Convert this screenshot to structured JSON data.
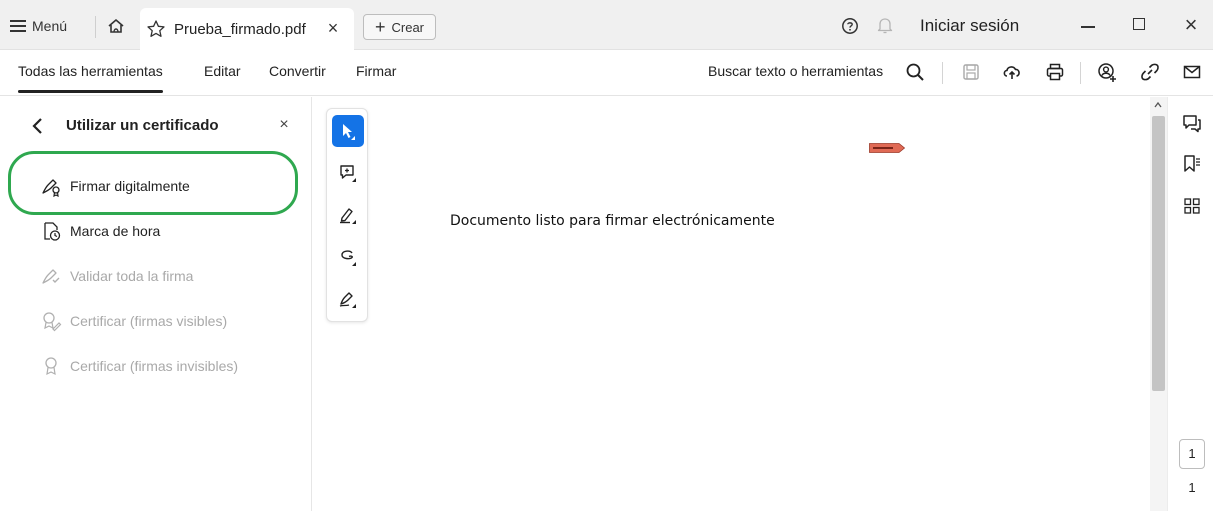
{
  "titlebar": {
    "menu_label": "Menú",
    "tab_title": "Prueba_firmado.pdf",
    "tab_close": "×",
    "create_plus": "+",
    "create_label": "Crear",
    "signin_label": "Iniciar sesión",
    "close_glyph": "×"
  },
  "toolbar": {
    "tabs": [
      "Todas las herramientas",
      "Editar",
      "Convertir",
      "Firmar"
    ],
    "active_tab": "Todas las herramientas",
    "search_label": "Buscar texto o herramientas"
  },
  "left_panel": {
    "title": "Utilizar un certificado",
    "close_glyph": "×",
    "items": [
      {
        "label": "Firmar digitalmente",
        "enabled": true
      },
      {
        "label": "Marca de hora",
        "enabled": true
      },
      {
        "label": "Validar toda la firma",
        "enabled": false
      },
      {
        "label": "Certificar (firmas visibles)",
        "enabled": false
      },
      {
        "label": "Certificar (firmas invisibles)",
        "enabled": false
      }
    ]
  },
  "document": {
    "body_text": "Documento listo para firmar electrónicamente"
  },
  "page_nav": {
    "current_page": "1",
    "total_pages": "1"
  },
  "colors": {
    "accent": "#1473e6",
    "highlight_ring": "#2fa84f",
    "disabled_text": "#a9a9a9",
    "tag": "#e06a55"
  },
  "icons": {
    "floating_tools": [
      "select-arrow-icon",
      "add-comment-icon",
      "highlight-pen-icon",
      "draw-freeform-icon",
      "sign-pen-icon"
    ],
    "right_rail": [
      "comments-icon",
      "bookmarks-icon",
      "thumbnails-icon"
    ]
  }
}
